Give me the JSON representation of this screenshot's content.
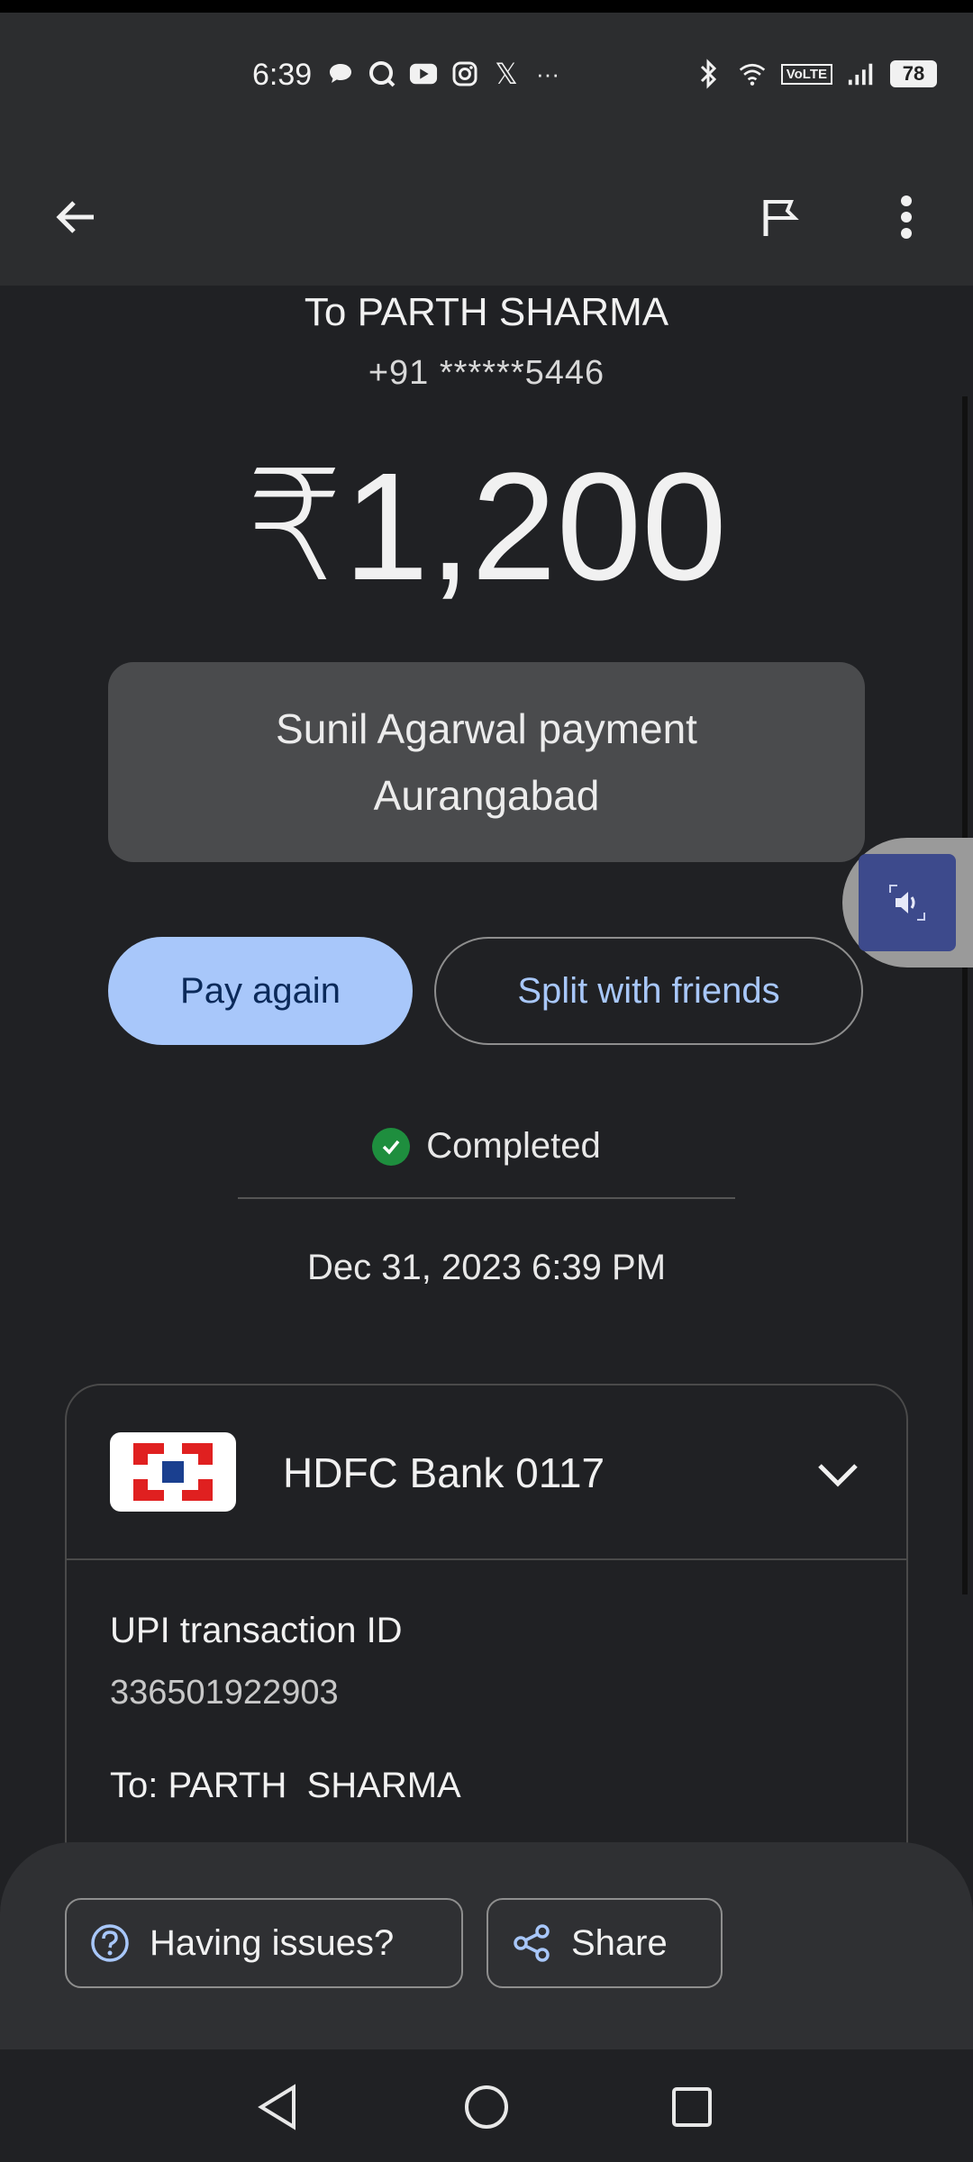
{
  "status_bar": {
    "time": "6:39",
    "battery": "78",
    "network_label": "VoLTE",
    "overflow": "···",
    "x_glyph": "𝕏"
  },
  "app_bar": {
    "back_icon": "arrow-left-icon",
    "flag_icon": "flag-icon",
    "more_icon": "more-vert-icon"
  },
  "transaction": {
    "recipient": "To PARTH SHARMA",
    "phone": "+91 ******5446",
    "amount": "₹1,200",
    "note_line1": "Sunil Agarwal payment",
    "note_line2": "Aurangabad",
    "status": "Completed",
    "datetime": "Dec 31, 2023 6:39 PM"
  },
  "actions": {
    "pay_again": "Pay again",
    "split": "Split with friends"
  },
  "bank_card": {
    "bank_name": "HDFC Bank 0117",
    "txn_label": "UPI transaction ID",
    "txn_id": "336501922903",
    "to_label": "To: PARTH  SHARMA"
  },
  "bottom": {
    "issues": "Having issues?",
    "share": "Share"
  },
  "colors": {
    "accent": "#a8c7fa",
    "success": "#1e8e3e",
    "hdfc_red": "#e02020",
    "hdfc_blue": "#1a3f8f"
  }
}
